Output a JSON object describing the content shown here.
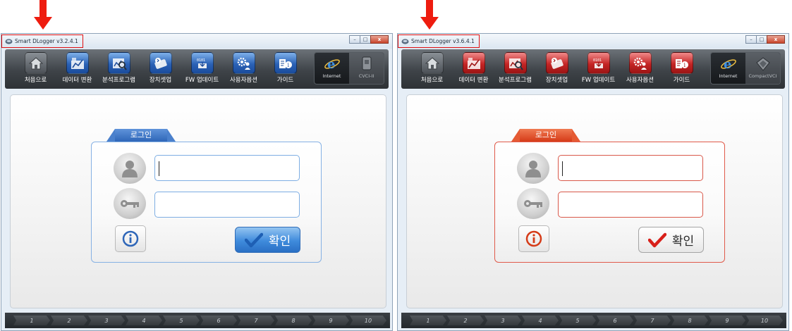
{
  "windows": [
    {
      "theme": "blue",
      "title": "Smart DLogger v3.2.4.1",
      "tools": [
        {
          "label": "처음으로",
          "icon": "home-icon"
        },
        {
          "label": "데이터 변환",
          "icon": "data-convert-icon"
        },
        {
          "label": "분석프로그램",
          "icon": "analysis-icon"
        },
        {
          "label": "장치셋업",
          "icon": "device-setup-icon"
        },
        {
          "label": "FW 업데이트",
          "icon": "firmware-icon"
        },
        {
          "label": "사용자옵션",
          "icon": "user-options-icon"
        },
        {
          "label": "가이드",
          "icon": "guide-icon"
        }
      ],
      "side": [
        {
          "label": "Internet",
          "icon": "internet-explorer-icon"
        },
        {
          "label": "CVCI-II",
          "icon": "cvci-device-icon"
        }
      ],
      "login_tab": "로그인",
      "username_value": "",
      "password_value": "",
      "ok_label": "확인",
      "pages": [
        "1",
        "2",
        "3",
        "4",
        "5",
        "6",
        "7",
        "8",
        "9",
        "10"
      ]
    },
    {
      "theme": "red",
      "title": "Smart DLogger v3.6.4.1",
      "tools": [
        {
          "label": "처음으로",
          "icon": "home-icon"
        },
        {
          "label": "데이터 변환",
          "icon": "data-convert-icon"
        },
        {
          "label": "분석프로그램",
          "icon": "analysis-icon"
        },
        {
          "label": "장치셋업",
          "icon": "device-setup-icon"
        },
        {
          "label": "FW 업데이트",
          "icon": "firmware-icon"
        },
        {
          "label": "사용자옵션",
          "icon": "user-options-icon"
        },
        {
          "label": "가이드",
          "icon": "guide-icon"
        }
      ],
      "side": [
        {
          "label": "Internet",
          "icon": "internet-explorer-icon"
        },
        {
          "label": "CompactVCI",
          "icon": "compactvci-device-icon"
        }
      ],
      "login_tab": "로그인",
      "username_value": "",
      "password_value": "",
      "ok_label": "확인",
      "pages": [
        "1",
        "2",
        "3",
        "4",
        "5",
        "6",
        "7",
        "8",
        "9",
        "10"
      ]
    }
  ],
  "colors": {
    "arrow": "#ee1c0f",
    "blue_accent": "#2e66b8",
    "red_accent": "#d53b18"
  }
}
